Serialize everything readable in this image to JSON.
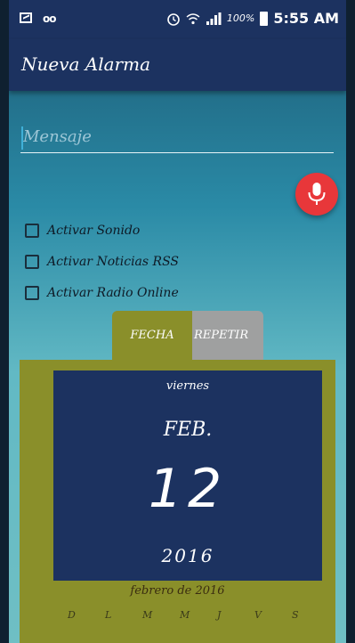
{
  "status_bar": {
    "battery_pct": "100%",
    "time": "5:55 AM",
    "icons": [
      "image-icon",
      "voicemail-icon",
      "alarm-icon",
      "wifi-icon",
      "signal-icon",
      "battery-icon"
    ]
  },
  "toolbar": {
    "title": "Nueva Alarma"
  },
  "message": {
    "placeholder": "Mensaje",
    "value": ""
  },
  "mic": {
    "icon": "microphone-icon",
    "color": "#e8373a"
  },
  "options": [
    {
      "label": "Activar Sonido",
      "checked": false
    },
    {
      "label": "Activar Noticias RSS",
      "checked": false
    },
    {
      "label": "Activar Radio Online",
      "checked": false
    }
  ],
  "tabs": [
    {
      "label": "FECHA",
      "selected": true
    },
    {
      "label": "REPETIR",
      "selected": false
    }
  ],
  "date_picker": {
    "day_of_week": "viernes",
    "month": "FEB.",
    "day": "12",
    "year": "2016",
    "calendar_title": "febrero de 2016",
    "weekdays": [
      "D",
      "L",
      "M",
      "M",
      "J",
      "V",
      "S"
    ]
  },
  "colors": {
    "primary": "#1c3260",
    "accent_panel": "#8a8f2a",
    "tab_inactive": "#9fa0a0",
    "fab": "#e8373a"
  }
}
